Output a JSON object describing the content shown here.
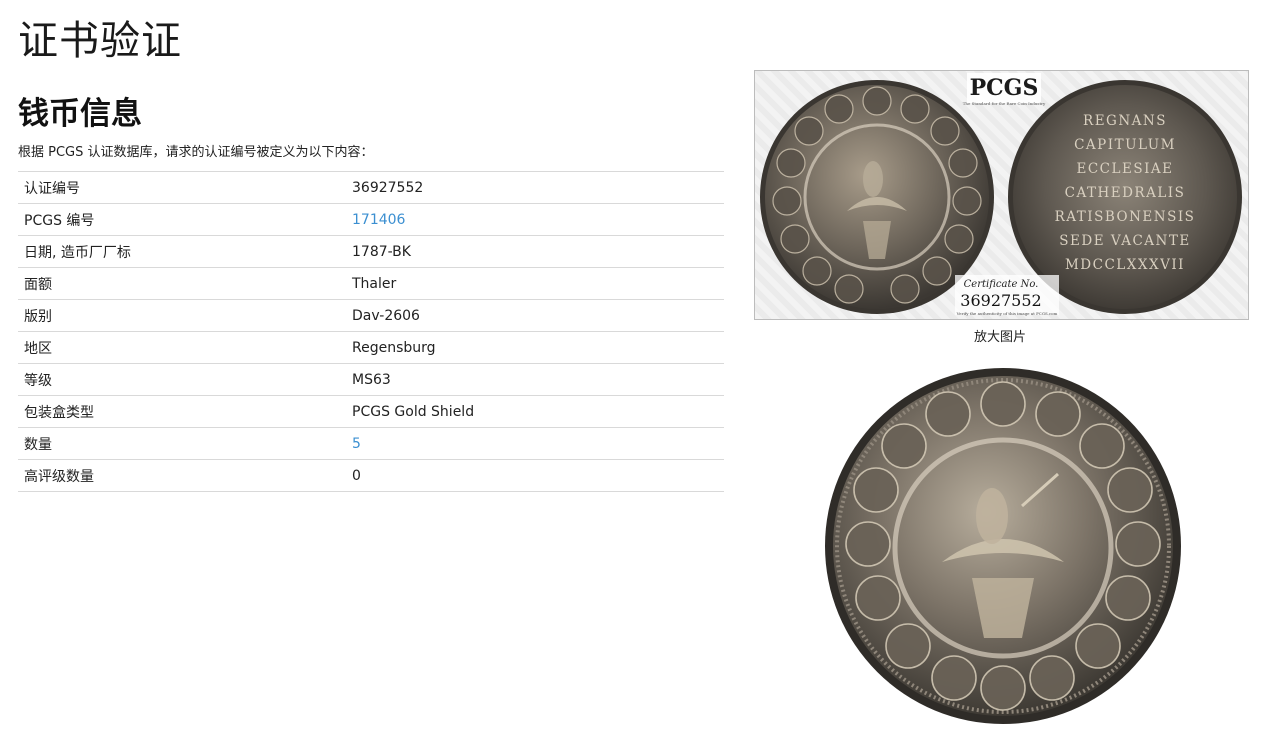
{
  "page": {
    "title": "证书验证"
  },
  "coin_info": {
    "heading": "钱币信息",
    "intro": "根据 PCGS 认证数据库，请求的认证编号被定义为以下内容："
  },
  "table": {
    "rows": [
      {
        "label": "认证编号",
        "value": "36927552",
        "link": false
      },
      {
        "label": "PCGS 编号",
        "value": "171406",
        "link": true
      },
      {
        "label": "日期, 造币厂厂标",
        "value": "1787-BK",
        "link": false
      },
      {
        "label": "面额",
        "value": "Thaler",
        "link": false
      },
      {
        "label": "版别",
        "value": "Dav-2606",
        "link": false
      },
      {
        "label": "地区",
        "value": "Regensburg",
        "link": false
      },
      {
        "label": "等级",
        "value": "MS63",
        "link": false
      },
      {
        "label": "包装盒类型",
        "value": "PCGS Gold Shield",
        "link": false
      },
      {
        "label": "数量",
        "value": "5",
        "link": true
      },
      {
        "label": "高评级数量",
        "value": "0",
        "link": false
      }
    ]
  },
  "slab_image": {
    "logo": "PCGS",
    "tagline": "The Standard for the Rare Coin Industry",
    "reverse_legend": [
      "REGNANS",
      "CAPITULUM",
      "ECCLESIAE",
      "CATHEDRALIS",
      "RATISBONENSIS",
      "SEDE VACANTE",
      "MDCCLXXXVII"
    ],
    "cert_label": "Certificate No.",
    "cert_number": "36927552",
    "verify_note": "Verify the authenticity of this image at PCGS.com",
    "enlarge_label": "放大图片"
  },
  "colors": {
    "link": "#3b8fd1",
    "coin_dark": "#4a4540",
    "coin_mid": "#7d7468",
    "coin_light": "#b0a594"
  }
}
